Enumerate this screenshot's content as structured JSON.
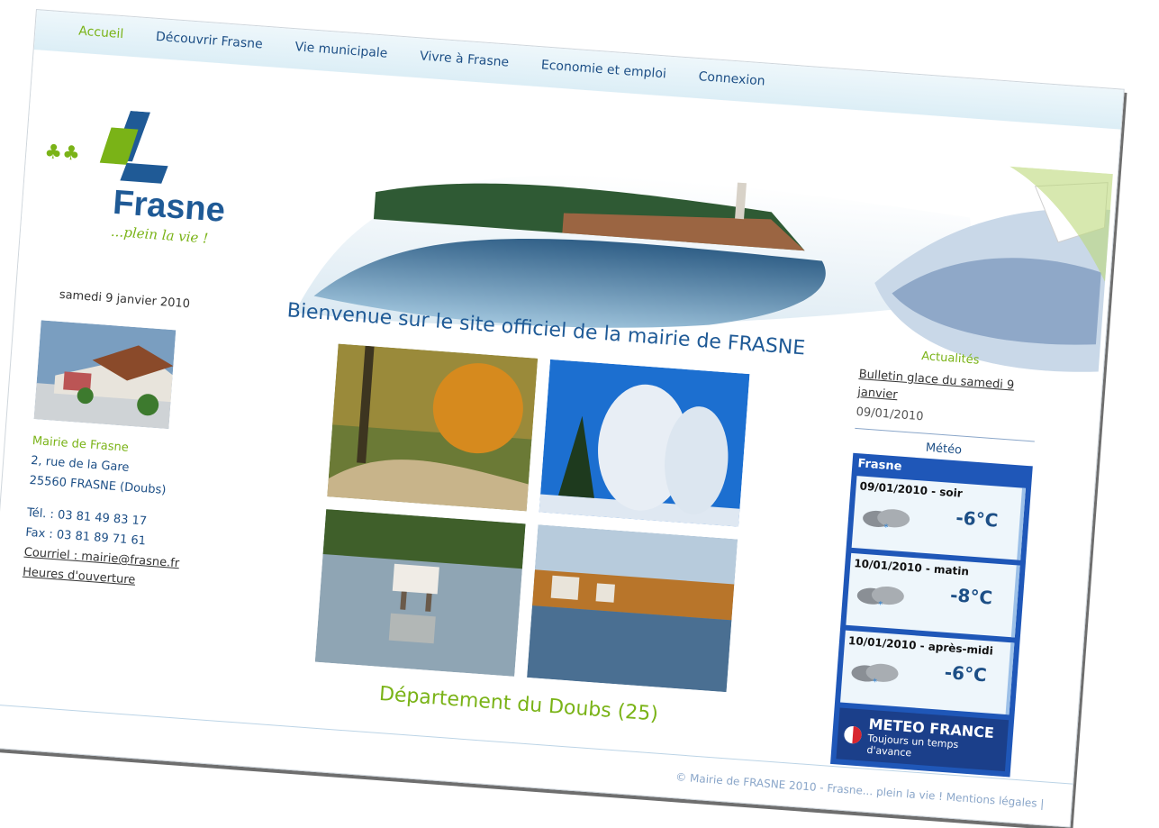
{
  "nav": {
    "items": [
      {
        "label": "Accueil",
        "active": true
      },
      {
        "label": "Découvrir Frasne"
      },
      {
        "label": "Vie municipale"
      },
      {
        "label": "Vivre à Frasne"
      },
      {
        "label": "Economie et emploi"
      },
      {
        "label": "Connexion"
      }
    ]
  },
  "brand": {
    "name": "Frasne",
    "slogan": "...plein la vie !"
  },
  "left": {
    "date": "samedi 9 janvier 2010",
    "address_title": "Mairie de Frasne",
    "address_line1": "2, rue de la Gare",
    "address_line2": "25560 FRASNE (Doubs)",
    "tel": "Tél. : 03 81 49 83 17",
    "fax": "Fax : 03 81 89 71 61",
    "email_link": "Courriel : mairie@frasne.fr",
    "hours_link": "Heures d'ouverture"
  },
  "center": {
    "welcome": "Bienvenue sur le site officiel de la mairie de FRASNE",
    "department": "Département du Doubs (25)"
  },
  "right": {
    "news_title": "Actualités",
    "news_link": "Bulletin glace du samedi 9 janvier",
    "news_date": "09/01/2010",
    "meteo_title": "Météo",
    "meteo_place": "Frasne",
    "forecasts": [
      {
        "when": "09/01/2010 - soir",
        "temp": "-6°C"
      },
      {
        "when": "10/01/2010 - matin",
        "temp": "-8°C"
      },
      {
        "when": "10/01/2010 - après-midi",
        "temp": "-6°C"
      }
    ],
    "meteo_brand": "METEO FRANCE",
    "meteo_tagline": "Toujours un temps d'avance"
  },
  "footer": {
    "text": "© Mairie de FRASNE 2010 - Frasne... plein la vie ! Mentions légales |"
  },
  "colors": {
    "accent_green": "#7ab317",
    "brand_blue": "#1f5a96",
    "meteo_blue": "#1f57b8"
  }
}
